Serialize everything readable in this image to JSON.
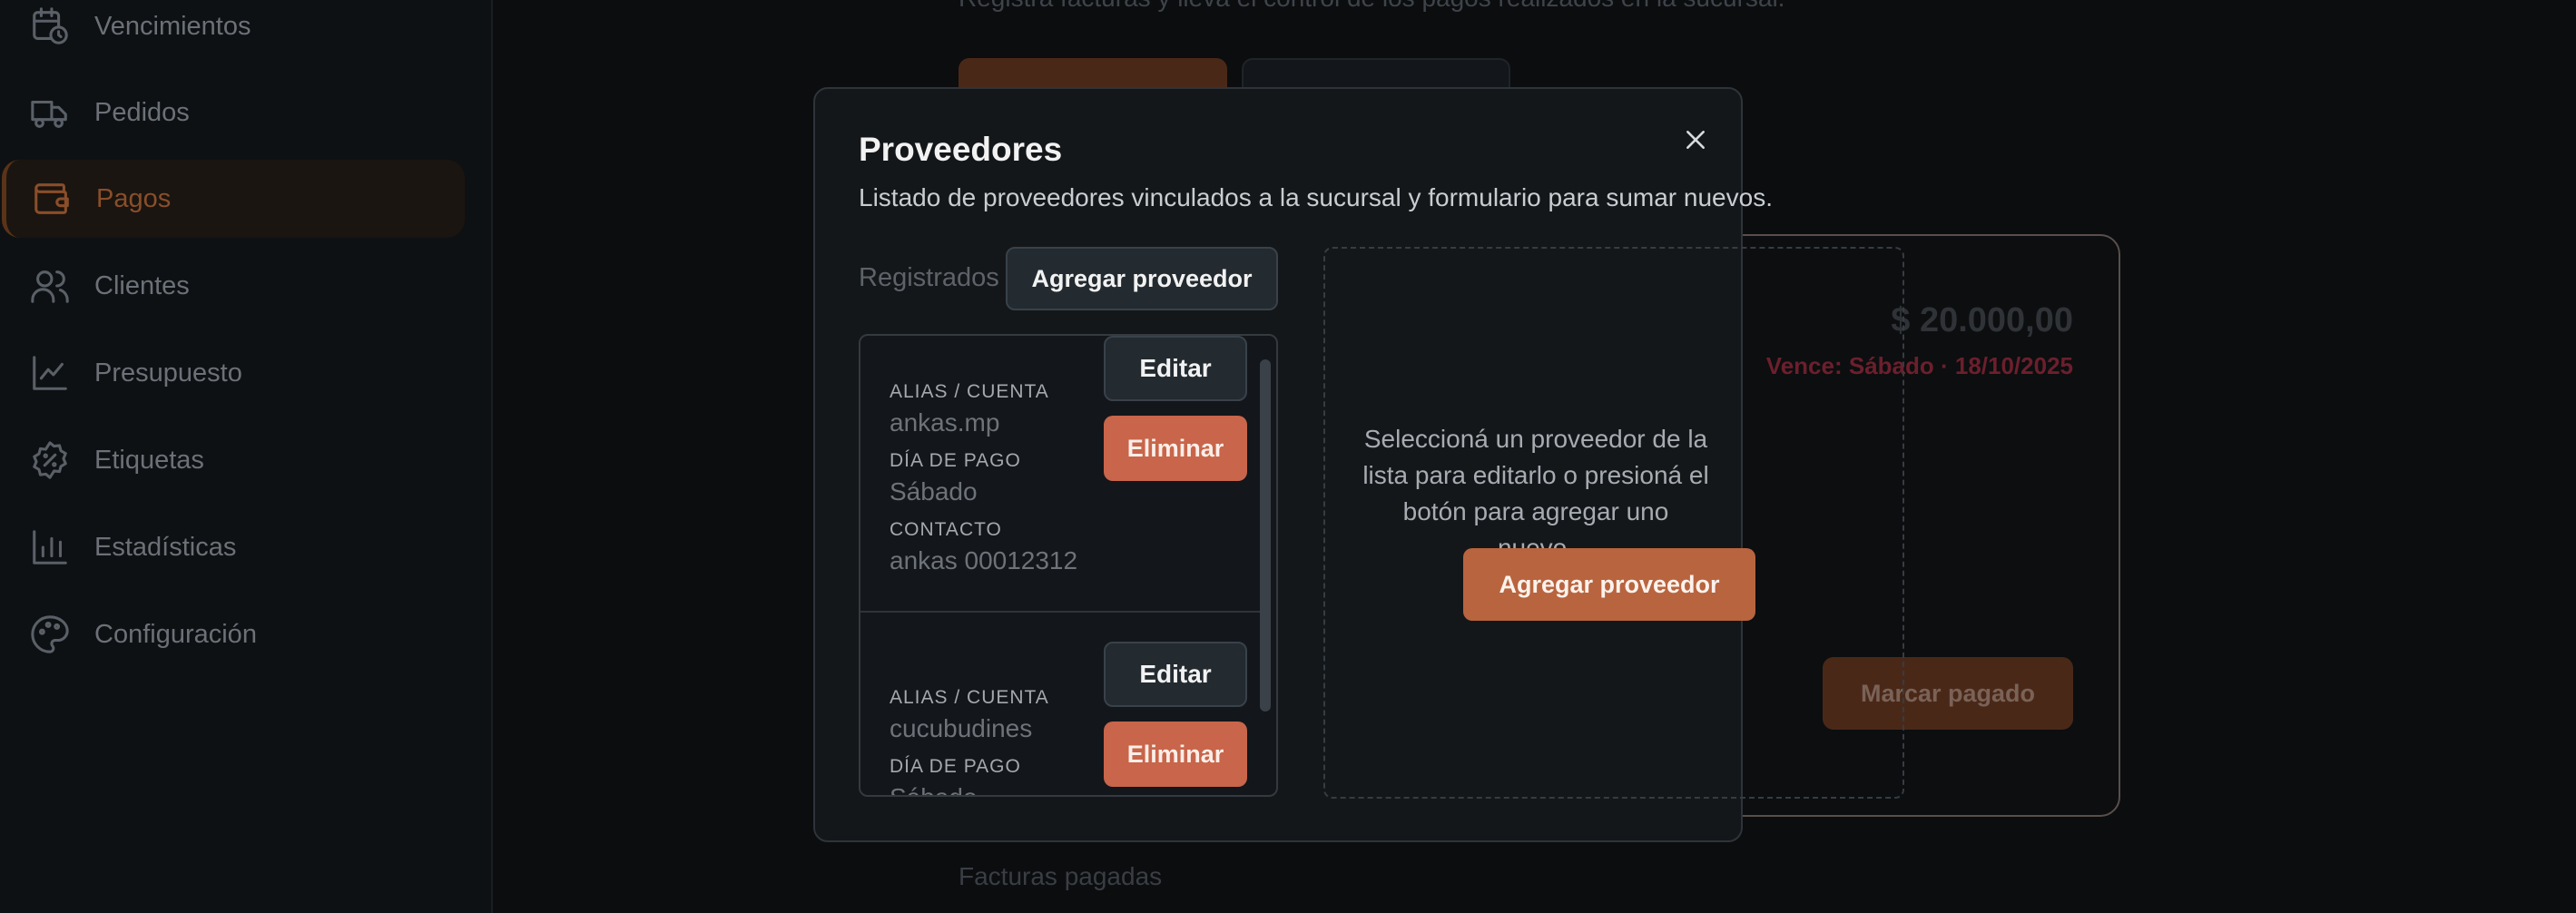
{
  "sidebar": {
    "items": [
      {
        "label": "Vencimientos",
        "icon": "calendar-clock-icon"
      },
      {
        "label": "Pedidos",
        "icon": "truck-icon"
      },
      {
        "label": "Pagos",
        "icon": "wallet-icon",
        "active": true
      },
      {
        "label": "Clientes",
        "icon": "users-icon"
      },
      {
        "label": "Presupuesto",
        "icon": "line-chart-icon"
      },
      {
        "label": "Etiquetas",
        "icon": "badge-percent-icon"
      },
      {
        "label": "Estadísticas",
        "icon": "bar-chart-icon"
      },
      {
        "label": "Configuración",
        "icon": "palette-icon"
      }
    ]
  },
  "background": {
    "subtitle": "Registra facturas y lleva el control de los pagos realizados en la sucursal.",
    "card": {
      "amount": "$ 20.000,00",
      "due": "Vence: Sábado · 18/10/2025",
      "mark_paid_label": "Marcar pagado"
    },
    "paid_section_title": "Facturas pagadas"
  },
  "modal": {
    "title": "Proveedores",
    "description": "Listado de proveedores vinculados a la sucursal y formulario para sumar nuevos.",
    "registered_label": "Registrados",
    "add_label": "Agregar proveedor",
    "providers": [
      {
        "alias_label": "ALIAS / CUENTA",
        "alias": "ankas.mp",
        "day_label": "DÍA DE PAGO",
        "day": "Sábado",
        "contact_label": "CONTACTO",
        "contact": "ankas 00012312",
        "edit_label": "Editar",
        "delete_label": "Eliminar"
      },
      {
        "alias_label": "ALIAS / CUENTA",
        "alias": "cucubudines",
        "day_label": "DÍA DE PAGO",
        "day": "Sábado",
        "edit_label": "Editar",
        "delete_label": "Eliminar"
      }
    ],
    "detail": {
      "empty_text": "Seleccioná un proveedor de la lista para editarlo o presioná el botón para agregar uno nuevo.",
      "add_label": "Agregar proveedor"
    }
  },
  "colors": {
    "accent": "#b8643f",
    "danger": "#c8654a",
    "due_text": "#6c1f2c"
  }
}
